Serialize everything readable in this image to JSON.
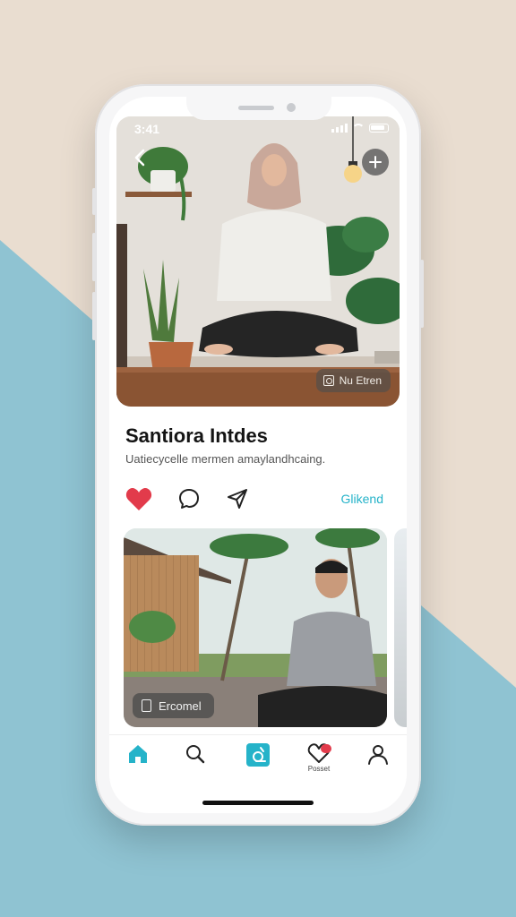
{
  "status_bar": {
    "time": "3:41"
  },
  "hero": {
    "tag_label": "Nu Etren"
  },
  "post": {
    "title": "Santiora Intdes",
    "subtitle": "Uatiecycelle mermen amaylandhcaing.",
    "friend_link": "Glikend"
  },
  "card2": {
    "tag_label": "Ercomel"
  },
  "tabbar": {
    "items": [
      {
        "icon": "home-icon",
        "label": ""
      },
      {
        "icon": "search-icon",
        "label": ""
      },
      {
        "icon": "create-icon",
        "label": ""
      },
      {
        "icon": "heart-icon",
        "label": "Posset"
      },
      {
        "icon": "profile-icon",
        "label": ""
      }
    ]
  },
  "colors": {
    "accent": "#25b3c9",
    "like": "#e23b4b",
    "background_beige": "#e9ddd0",
    "background_blue": "#8fc3d2"
  }
}
